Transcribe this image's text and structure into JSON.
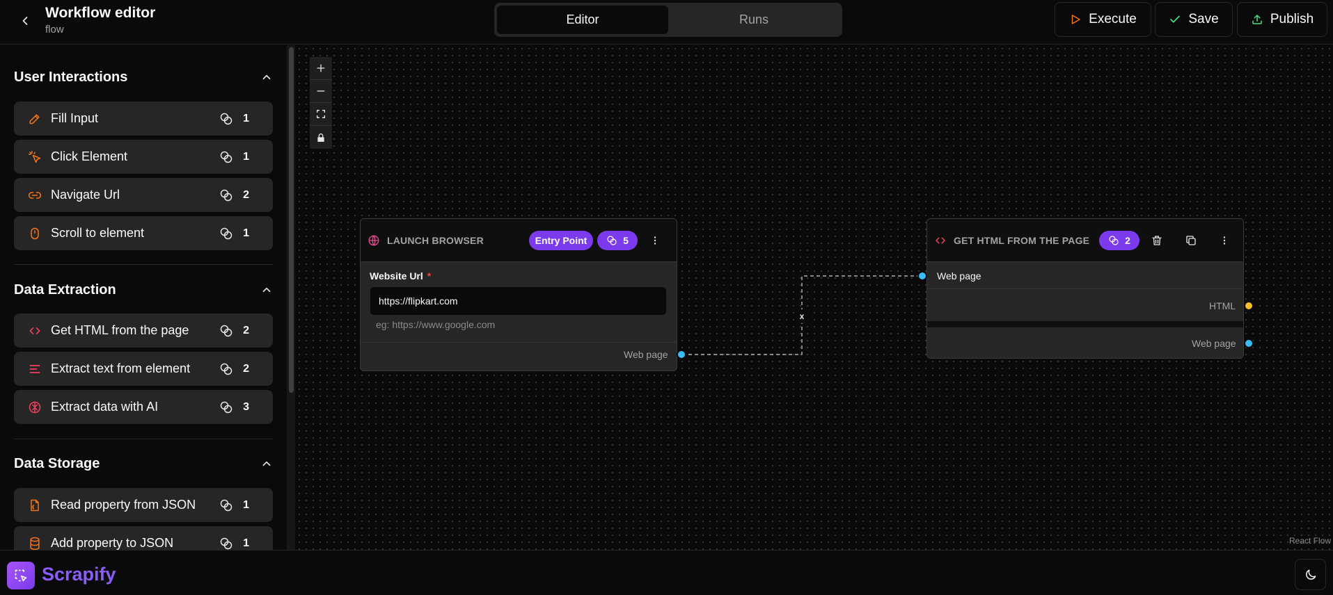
{
  "header": {
    "title": "Workflow editor",
    "subtitle": "flow",
    "tabs": [
      {
        "label": "Editor",
        "active": true
      },
      {
        "label": "Runs",
        "active": false
      }
    ],
    "actions": {
      "execute": "Execute",
      "save": "Save",
      "publish": "Publish"
    }
  },
  "sidebar": {
    "sections": [
      {
        "title": "User Interactions",
        "items": [
          {
            "label": "Fill Input",
            "icon": "pencil-icon",
            "credits": "1"
          },
          {
            "label": "Click Element",
            "icon": "pointer-click-icon",
            "credits": "1"
          },
          {
            "label": "Navigate Url",
            "icon": "link-icon",
            "credits": "2"
          },
          {
            "label": "Scroll to element",
            "icon": "mouse-icon",
            "credits": "1"
          }
        ]
      },
      {
        "title": "Data Extraction",
        "items": [
          {
            "label": "Get HTML from the page",
            "icon": "code-icon",
            "credits": "2"
          },
          {
            "label": "Extract text from element",
            "icon": "text-icon",
            "credits": "2"
          },
          {
            "label": "Extract data with AI",
            "icon": "brain-icon",
            "credits": "3"
          }
        ]
      },
      {
        "title": "Data Storage",
        "items": [
          {
            "label": "Read property from JSON",
            "icon": "file-json-icon",
            "credits": "1"
          },
          {
            "label": "Add property to JSON",
            "icon": "database-icon",
            "credits": "1"
          }
        ]
      }
    ]
  },
  "canvas": {
    "nodes": {
      "launch": {
        "title": "LAUNCH BROWSER",
        "entry_badge": "Entry Point",
        "credits": "5",
        "input_label": "Website Url",
        "required_mark": "*",
        "input_value": "https://flipkart.com",
        "input_hint": "eg: https://www.google.com",
        "output_label": "Web page"
      },
      "gethtml": {
        "title": "GET HTML FROM THE PAGE",
        "credits": "2",
        "input_label": "Web page",
        "output_html_label": "HTML",
        "output_page_label": "Web page"
      }
    },
    "edge_delete": "x",
    "attribution": "React Flow"
  },
  "footer": {
    "brand": "Scrapify"
  },
  "colors": {
    "accent": "#7c3aed",
    "brand": "#8b5cf6",
    "icon_orange": "#f97316",
    "handle_blue": "#38bdf8",
    "handle_yellow": "#fbbf24"
  }
}
